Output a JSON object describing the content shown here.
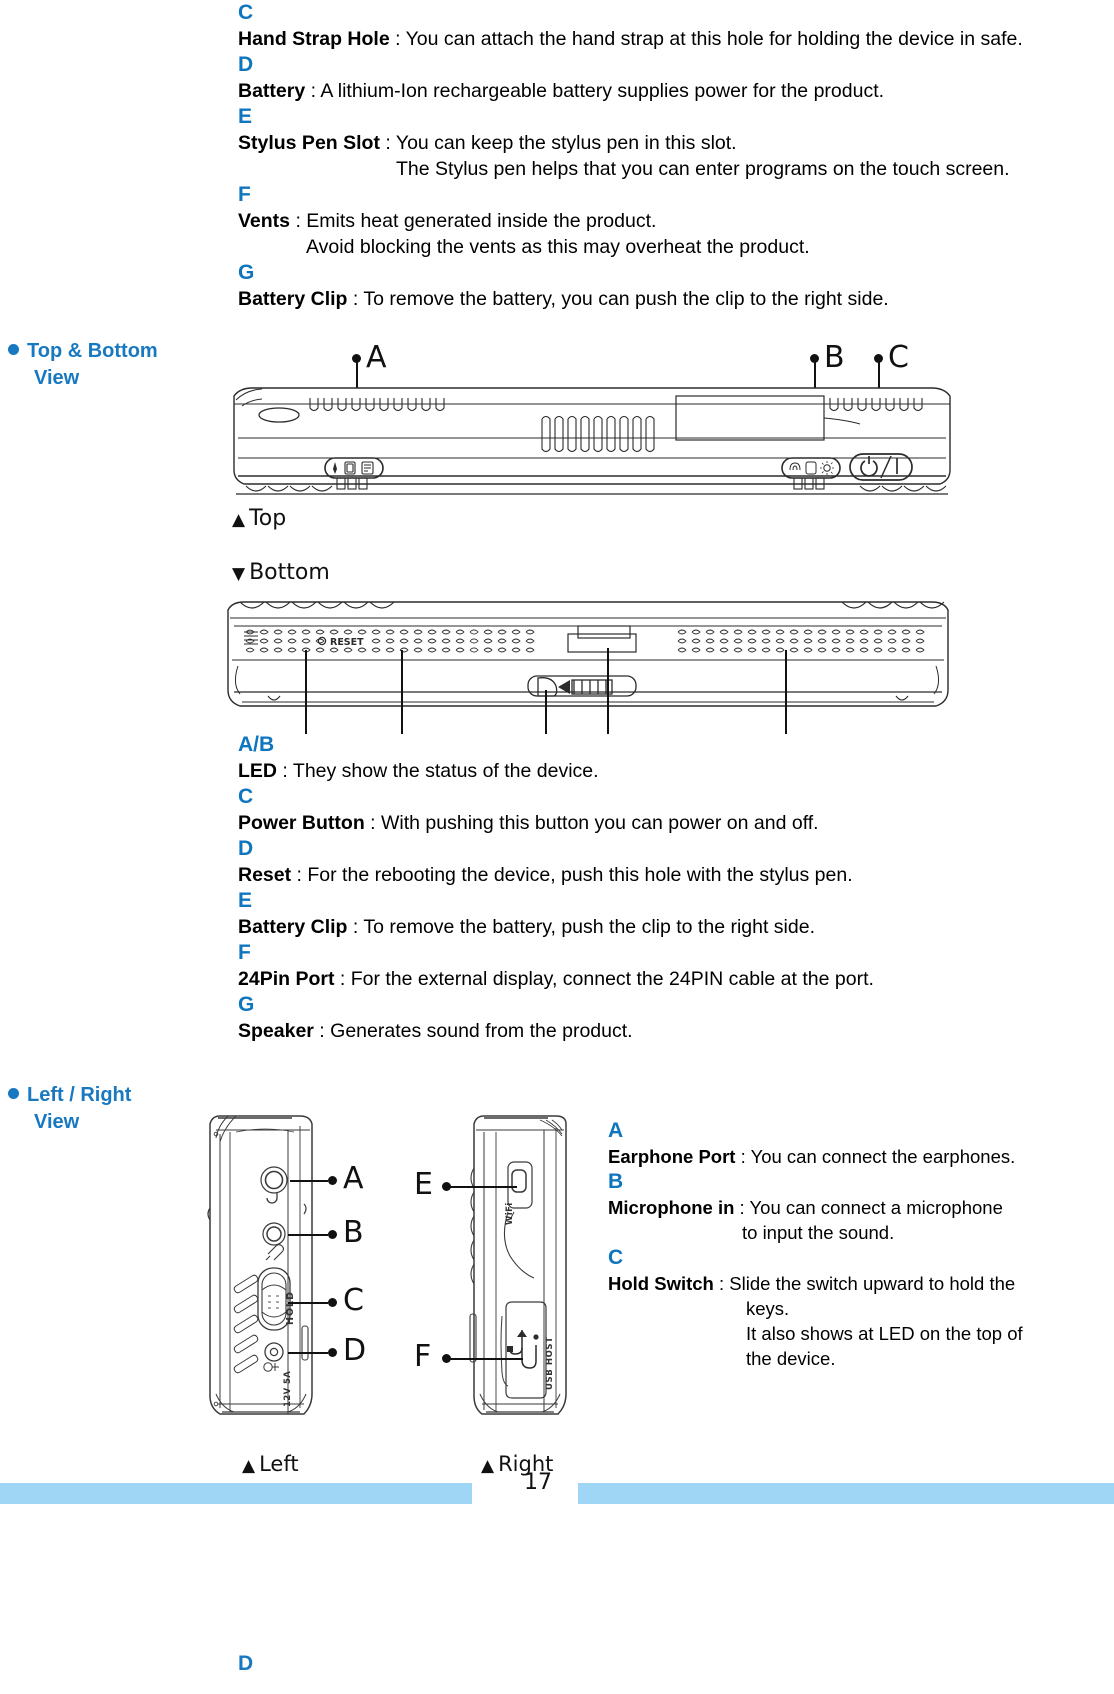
{
  "page": {
    "number": "17",
    "trailing_letter": "D"
  },
  "front_view_items": [
    {
      "letter": "C",
      "term": "Hand Strap Hole",
      "sep": " : ",
      "desc": "You can attach the hand strap at this hole for holding the device in safe.",
      "extra": []
    },
    {
      "letter": "D",
      "term": "Battery",
      "sep": " : ",
      "desc": "A lithium-Ion rechargeable battery supplies power for the product.",
      "extra": []
    },
    {
      "letter": "E",
      "term": "Stylus Pen Slot",
      "sep": " : ",
      "desc": "You can keep the stylus pen in this slot.",
      "extra": [
        "The Stylus pen helps that you can enter programs on the touch screen."
      ]
    },
    {
      "letter": "F",
      "term": "Vents",
      "sep": " : ",
      "desc": "Emits heat generated inside the product.",
      "extra": [
        "Avoid blocking the vents as this may overheat the product."
      ]
    },
    {
      "letter": "G",
      "term": "Battery Clip",
      "sep": " : ",
      "desc": "To remove the battery, you can push the clip to the right side.",
      "extra": []
    }
  ],
  "sections": {
    "top_bottom": {
      "line1": "Top & Bottom",
      "line2": "View"
    },
    "left_right": {
      "line1": "Left / Right",
      "line2": "View"
    }
  },
  "captions": {
    "top": "Top",
    "top_marker": "▲",
    "bottom": "Bottom",
    "bottom_marker": "▼",
    "left": "Left",
    "left_marker": "▲",
    "right": "Right",
    "right_marker": "▲"
  },
  "top_view_callouts": [
    "A",
    "B",
    "C"
  ],
  "left_view_callouts": [
    "A",
    "B",
    "C",
    "D"
  ],
  "right_view_callouts": [
    "E",
    "F"
  ],
  "device_labels": {
    "reset": "RESET",
    "hold": "HOLD",
    "wifi": "WiFi",
    "usb_host": "USB HOST",
    "dc_in": "12V 5A"
  },
  "top_bottom_items": [
    {
      "letter": "A/B",
      "term": "LED",
      "sep": " : ",
      "desc": "They show the status of the device.",
      "extra": []
    },
    {
      "letter": "C",
      "term": "Power Button",
      "sep": " : ",
      "desc": "With pushing this button you can power on and off.",
      "extra": []
    },
    {
      "letter": "D",
      "term": "Reset",
      "sep": " : ",
      "desc": "For the rebooting the device, push this hole with the stylus pen.",
      "extra": []
    },
    {
      "letter": "E",
      "term": "Battery Clip",
      "sep": " : ",
      "desc": "To remove the battery, push the clip to the right side.",
      "extra": []
    },
    {
      "letter": "F",
      "term": "24Pin Port",
      "sep": " : ",
      "desc": "For the external display, connect the 24PIN cable at the port.",
      "extra": []
    },
    {
      "letter": "G",
      "term": "Speaker",
      "sep": " : ",
      "desc": "Generates sound from the product.",
      "extra": []
    }
  ],
  "left_right_items": [
    {
      "letter": "A",
      "term": "Earphone Port",
      "sep": " : ",
      "desc": "You can connect the earphones.",
      "extra": []
    },
    {
      "letter": "B",
      "term": "Microphone in",
      "sep": " : ",
      "desc": "You can connect a microphone",
      "extra": [
        "to input the sound."
      ]
    },
    {
      "letter": "C",
      "term": "Hold Switch",
      "sep": " : ",
      "desc": "Slide the switch upward to hold the",
      "extra": [
        "keys.",
        "It also shows at LED on the top of",
        "the device."
      ]
    }
  ],
  "colors": {
    "accent_blue": "#1878c0",
    "letter_blue": "#0f75bd",
    "footer_bar": "#9fd6f5",
    "line": "#111111"
  }
}
